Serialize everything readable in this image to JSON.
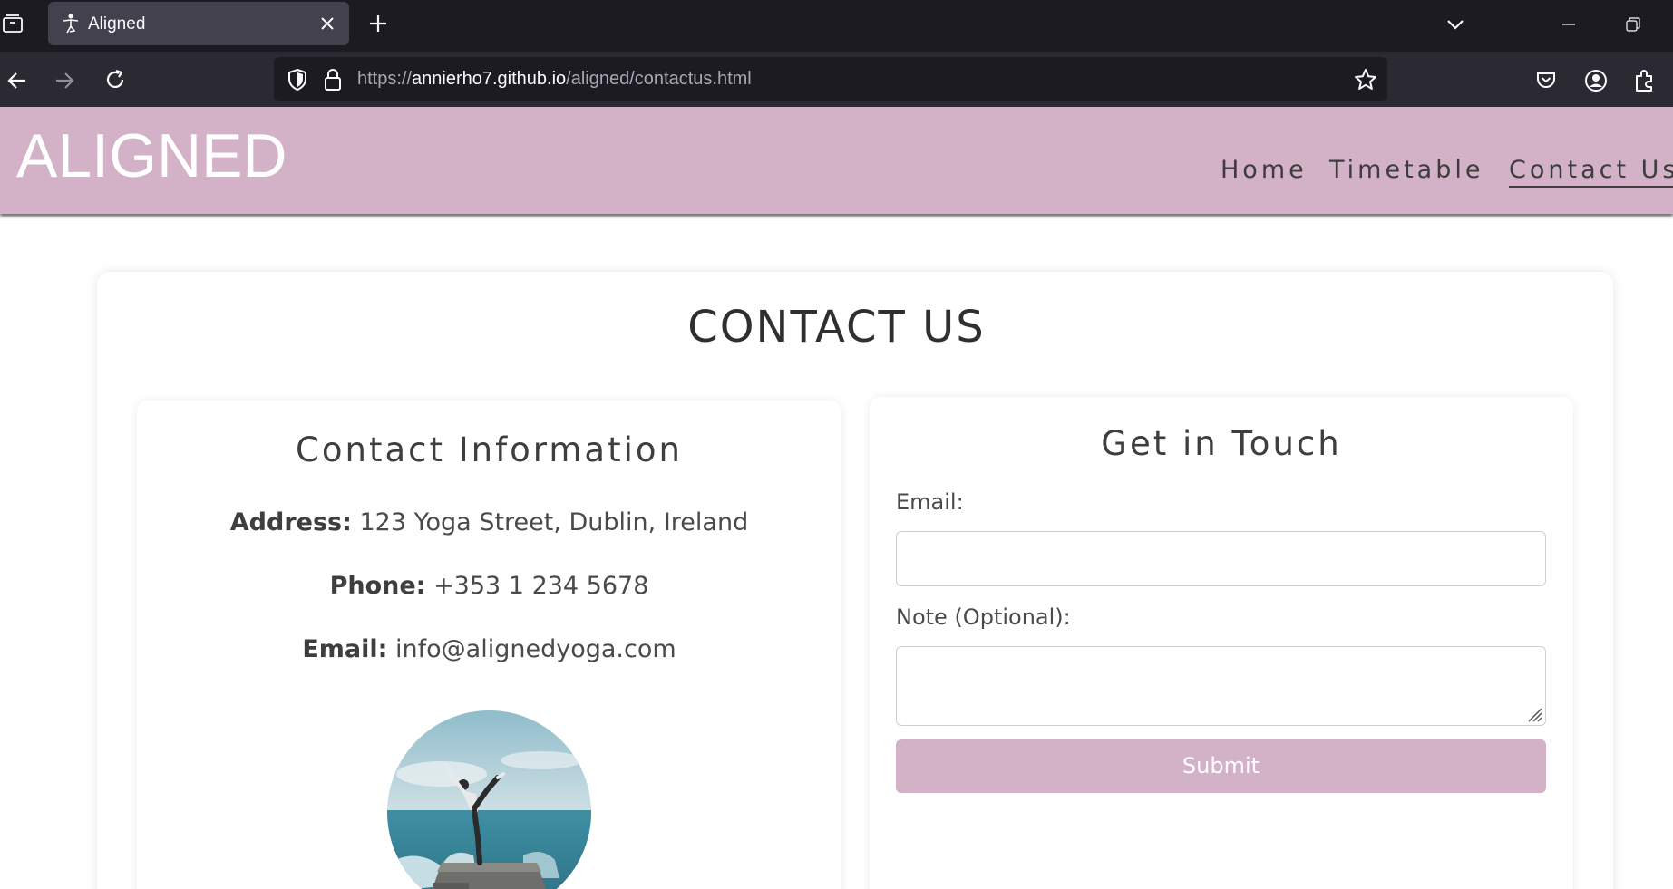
{
  "browser": {
    "tab_title": "Aligned",
    "url_prefix": "https://",
    "url_host": "annierho7.github.io",
    "url_path": "/aligned/contactus.html"
  },
  "site": {
    "logo": "ALIGNED",
    "nav": {
      "home": "Home",
      "timetable": "Timetable",
      "contact": "Contact Us"
    }
  },
  "page": {
    "title": "CONTACT US"
  },
  "contact_info": {
    "heading": "Contact Information",
    "address_label": "Address:",
    "address_value": "123 Yoga Street, Dublin, Ireland",
    "phone_label": "Phone:",
    "phone_value": "+353 1 234 5678",
    "email_label": "Email:",
    "email_value": "info@alignedyoga.com"
  },
  "form": {
    "heading": "Get in Touch",
    "email_label": "Email:",
    "note_label": "Note (Optional):",
    "submit_label": "Submit"
  },
  "colors": {
    "brand_pink": "#d3b1c7",
    "browser_dark": "#1c1b22"
  }
}
